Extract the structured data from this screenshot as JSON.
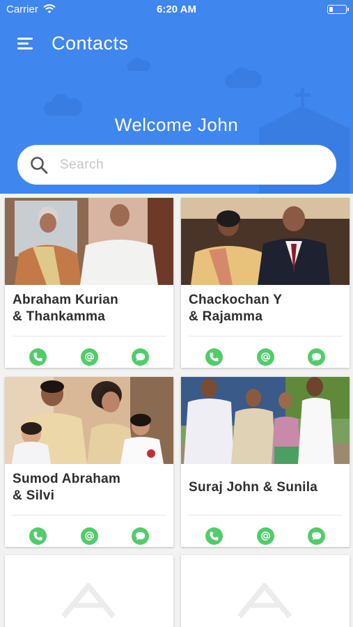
{
  "status_bar": {
    "carrier": "Carrier",
    "time": "6:20 AM",
    "battery_level": 0.25
  },
  "header": {
    "title": "Contacts",
    "welcome": "Welcome John",
    "bg_color": "#3f86ee"
  },
  "search": {
    "placeholder": "Search",
    "value": ""
  },
  "accent_color": "#52cc6a",
  "contacts": [
    {
      "name_line1": "Abraham Kurian",
      "name_line2": "& Thankamma",
      "photo": "couple-photo"
    },
    {
      "name_line1": "Chackochan Y",
      "name_line2": "& Rajamma",
      "photo": "couple-photo"
    },
    {
      "name_line1": "Sumod Abraham",
      "name_line2": "& Silvi",
      "photo": "family-photo"
    },
    {
      "name_line1": "Suraj John & Sunila",
      "name_line2": "",
      "photo": "family-photo"
    }
  ],
  "actions": {
    "call": "phone-icon",
    "email": "email-icon",
    "message": "chat-icon"
  }
}
